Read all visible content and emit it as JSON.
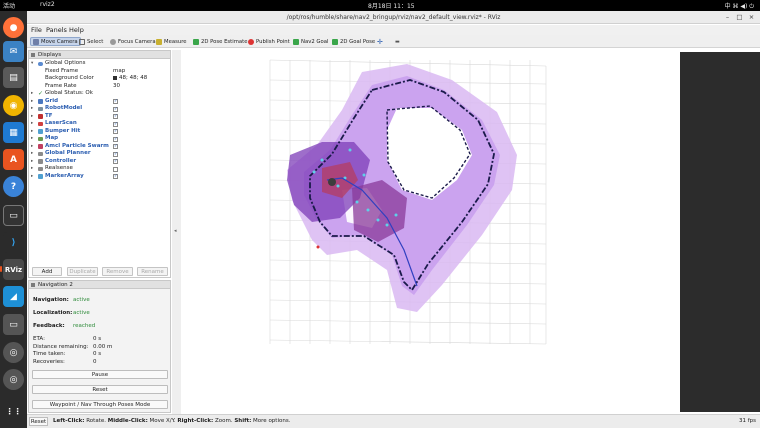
{
  "topbar": {
    "activities": "活动",
    "app": "rviz2",
    "clock": "8月18日  11：15",
    "tray": "中  ⌘  ◀)  ⏻"
  },
  "window": {
    "title": "/opt/ros/humble/share/nav2_bringup/rviz/nav2_default_view.rviz* - RViz",
    "minimize": "–",
    "maximize": "□",
    "close": "×"
  },
  "menu": [
    "File",
    "Panels",
    "Help"
  ],
  "toolbar": {
    "move_camera": "Move Camera",
    "select": "Select",
    "focus_camera": "Focus Camera",
    "measure": "Measure",
    "pose_estimate": "2D Pose Estimate",
    "publish_point": "Publish Point",
    "nav2_goal": "Nav2 Goal",
    "goal_pose": "2D Goal Pose",
    "plus": "✛",
    "minus": "▬"
  },
  "displays": {
    "header": "Displays",
    "global_options": "Global Options",
    "fixed_frame_label": "Fixed Frame",
    "fixed_frame_value": "map",
    "bg_color_label": "Background Color",
    "bg_color_value": "48; 48; 48",
    "frame_rate_label": "Frame Rate",
    "frame_rate_value": "30",
    "global_status": "Global Status: Ok",
    "items": [
      "Grid",
      "RobotModel",
      "TF",
      "LaserScan",
      "Bumper Hit",
      "Map",
      "Amcl Particle Swarm",
      "Global Planner",
      "Controller",
      "Realsense",
      "MarkerArray"
    ],
    "checked": [
      "✓",
      "✓",
      "✓",
      "✓",
      "✓",
      "✓",
      "✓",
      "✓",
      "✓",
      "",
      "✓"
    ],
    "buttons": {
      "add": "Add",
      "duplicate": "Duplicate",
      "remove": "Remove",
      "rename": "Rename"
    }
  },
  "navigation": {
    "header": "Navigation 2",
    "navigation_label": "Navigation:",
    "navigation_value": "active",
    "localization_label": "Localization:",
    "localization_value": "active",
    "feedback_label": "Feedback:",
    "feedback_value": "reached",
    "eta_label": "ETA:",
    "eta_value": "0 s",
    "distance_label": "Distance remaining:",
    "distance_value": "0.00 m",
    "time_label": "Time taken:",
    "time_value": "0 s",
    "recoveries_label": "Recoveries:",
    "recoveries_value": "0",
    "pause": "Pause",
    "reset": "Reset",
    "waypoint": "Waypoint / Nav Through Poses Mode"
  },
  "status": {
    "reset": "Reset",
    "hint_left": "Left-Click:",
    "hint_left_text": " Rotate. ",
    "hint_middle": "Middle-Click:",
    "hint_middle_text": " Move X/Y. ",
    "hint_right": "Right-Click:",
    "hint_right_text": " Zoom. ",
    "hint_shift": "Shift:",
    "hint_shift_text": " More options.",
    "fps": "31 fps"
  },
  "colors": {
    "accent": "#e95420",
    "link_blue": "#2a5db0",
    "status_green": "#2e8b3a",
    "costmap": "#c9a4f0",
    "path": "#1a1a4a"
  }
}
